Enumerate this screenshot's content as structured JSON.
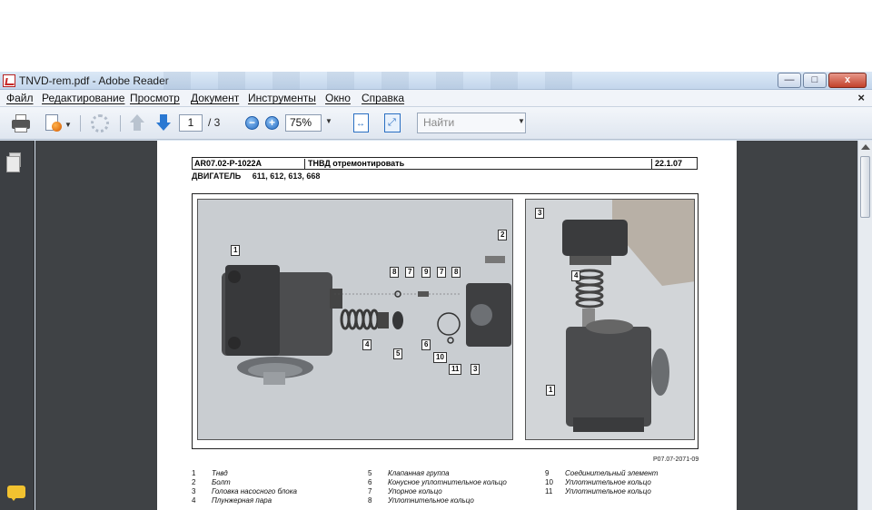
{
  "window": {
    "title": "TNVD-rem.pdf - Adobe Reader",
    "controls": {
      "minimize": "—",
      "maximize": "□",
      "close": "x"
    }
  },
  "menu": {
    "items": [
      "Файл",
      "Редактирование",
      "Просмотр",
      "Документ",
      "Инструменты",
      "Окно",
      "Справка"
    ],
    "close": "×"
  },
  "toolbar": {
    "current_page": "1",
    "page_total": "/ 3",
    "zoom_out": "−",
    "zoom_in": "+",
    "zoom": "75%",
    "search_placeholder": "Найти"
  },
  "document": {
    "doc_code": "AR07.02-P-1022A",
    "doc_title": "ТНВД отремонтировать",
    "doc_date": "22.1.07",
    "engine_label": "ДВИГАТЕЛЬ",
    "engine_models": "611, 612, 613, 668",
    "figure_id": "P07.07-2071-09",
    "callouts_left": [
      "1",
      "2",
      "8",
      "7",
      "9",
      "7",
      "8",
      "4",
      "5",
      "6",
      "10",
      "11",
      "3"
    ],
    "callouts_right": [
      "3",
      "4",
      "1"
    ],
    "legend": [
      {
        "n": "1",
        "text": "Тнвд"
      },
      {
        "n": "2",
        "text": "Болт"
      },
      {
        "n": "3",
        "text": "Головка насосного блока"
      },
      {
        "n": "4",
        "text": "Плунжерная пара"
      },
      {
        "n": "5",
        "text": "Клапанная группа"
      },
      {
        "n": "6",
        "text": "Конусное уплотнительное кольцо"
      },
      {
        "n": "7",
        "text": "Упорное кольцо"
      },
      {
        "n": "8",
        "text": "Уплотнительное кольцо"
      },
      {
        "n": "9",
        "text": "Соединительный элемент"
      },
      {
        "n": "10",
        "text": "Уплотнительное кольцо"
      },
      {
        "n": "11",
        "text": "Уплотнительное кольцо"
      }
    ]
  }
}
